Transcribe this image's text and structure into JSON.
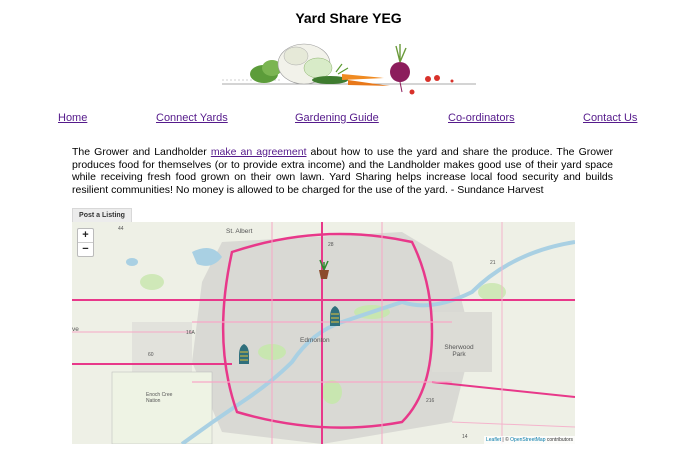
{
  "site": {
    "title": "Yard Share YEG"
  },
  "nav": {
    "items": [
      {
        "label": "Home"
      },
      {
        "label": "Connect Yards"
      },
      {
        "label": "Gardening Guide"
      },
      {
        "label": "Co-ordinators"
      },
      {
        "label": "Contact Us"
      }
    ]
  },
  "intro": {
    "before_link": "The Grower and Landholder ",
    "link_text": "make an agreement",
    "after_link": " about how to use the yard and share the produce. The Grower produces food for themselves (or to provide extra income) and the Landholder makes good use of their yard space while receiving fresh food grown on their own lawn. Yard Sharing helps increase local food security and builds resilient communities! No money is allowed to be charged for the use of the yard. - Sundance Harvest"
  },
  "map": {
    "tab_label": "Post a Listing",
    "zoom_in": "+",
    "zoom_out": "−",
    "labels": {
      "st_albert": "St. Albert",
      "edmonton": "Edmonton",
      "sherwood_park": "Sherwood Park",
      "highway_216": "216",
      "highway_44": "44",
      "highway_28": "28",
      "highway_21": "21",
      "highway_16a": "16A",
      "highway_14": "14",
      "highway_60": "60",
      "enoch_area": "Enoch Cree Nation",
      "ve": "ve"
    },
    "attribution": {
      "leaflet": "Leaflet",
      "separator": " | © ",
      "osm": "OpenStreetMap",
      "suffix": " contributors"
    },
    "markers": [
      {
        "icon": "plant-pot-icon"
      },
      {
        "icon": "watering-can-icon"
      },
      {
        "icon": "watering-can-icon"
      }
    ]
  },
  "colors": {
    "link": "#551a8b",
    "road": "#e8388a",
    "river": "#a9d0e3",
    "park": "#c8e6b0",
    "urban": "#d9d9d4"
  }
}
